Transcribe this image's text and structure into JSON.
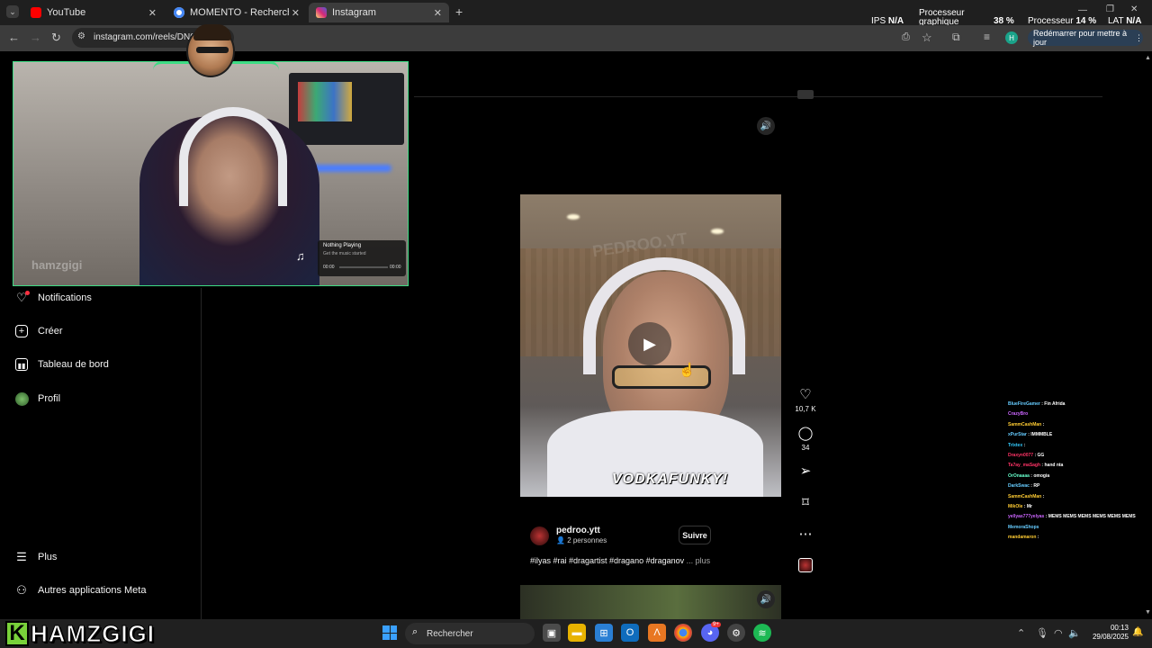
{
  "browser": {
    "tabs": [
      {
        "title": "YouTube",
        "color": "#ff0000"
      },
      {
        "title": "MOMENTO - Recherche Google",
        "color": "#4285f4"
      },
      {
        "title": "Instagram",
        "color": "#e1306c"
      }
    ],
    "new_tab": "+",
    "url": "instagram.com/reels/DN0",
    "restart_label": "Redémarrer pour mettre à jour",
    "profile_initial": "H"
  },
  "perf_overlay": {
    "ips_label": "IPS",
    "ips_value": "N/A",
    "gpu_label_1": "Processeur",
    "gpu_label_2": "graphique",
    "gpu_value": "38 %",
    "cpu_label": "Processeur",
    "cpu_value": "14 %",
    "lat_label": "LAT",
    "lat_value": "N/A"
  },
  "sidebar": {
    "items": [
      {
        "label": "Notifications",
        "icon": "heart-icon"
      },
      {
        "label": "Créer",
        "icon": "plus-square-icon"
      },
      {
        "label": "Tableau de bord",
        "icon": "chart-icon"
      },
      {
        "label": "Profil",
        "icon": "profile-avatar"
      }
    ],
    "bottom": [
      {
        "label": "Plus",
        "icon": "menu-icon"
      },
      {
        "label": "Autres applications Meta",
        "icon": "meta-apps-icon"
      }
    ]
  },
  "webcam": {
    "watermark": "hamzgigi",
    "now_playing_title": "Nothing Playing",
    "now_playing_sub": "Get the music started",
    "time_start": "00:00",
    "time_end": "00:00"
  },
  "reel": {
    "caption_overlay": "VODKAFUNKY!",
    "watermark": "PEDROO.YT",
    "username": "pedroo.ytt",
    "people": "2 personnes",
    "follow_label": "Suivre",
    "hashtags": "#ilyas #rai #dragartist #dragano #draganov",
    "more": "... plus",
    "likes": "10,7 K",
    "comments": "34"
  },
  "chat": [
    {
      "user": "BlueFireGamer",
      "msg": ": Fin Afrida",
      "color": "#66ccff"
    },
    {
      "user": "CrazyBro",
      "msg": "",
      "color": "#cc66ff"
    },
    {
      "user": "SammCashMan",
      "msg": ":",
      "color": "#ffcc33"
    },
    {
      "user": "xPurStar",
      "msg": ": IMMMBLE",
      "color": "#66ccff"
    },
    {
      "user": "Trixtex",
      "msg": ":",
      "color": "#33ccff"
    },
    {
      "user": "Draxyn0077",
      "msg": ": GG",
      "color": "#ff3366"
    },
    {
      "user": "Ta7ay_maSagh",
      "msg": ": hand nta",
      "color": "#ff3366"
    },
    {
      "user": "OrOnaaaa",
      "msg": ": omogia",
      "color": "#66ffcc"
    },
    {
      "user": "DarkSwac",
      "msg": ": RP",
      "color": "#66ccff"
    },
    {
      "user": "SammCashMan",
      "msg": ":",
      "color": "#ffcc33"
    },
    {
      "user": "MikOle",
      "msg": ": Mr",
      "color": "#ffcc33"
    },
    {
      "user": "yellyas777yelyas",
      "msg": ": MEMS MEMS MEMS MEMS MEMS MEMS",
      "color": "#cc66ff"
    },
    {
      "user": "MemoraShops",
      "msg": "",
      "color": "#66ccff"
    },
    {
      "user": "mandamaron",
      "msg": ":",
      "color": "#ffcc33"
    }
  ],
  "taskbar": {
    "search_placeholder": "Rechercher",
    "time": "00:13",
    "date": "29/08/2025",
    "discord_badge": "9+"
  },
  "logo": {
    "k": "K",
    "text": "HAMZGIGI"
  }
}
